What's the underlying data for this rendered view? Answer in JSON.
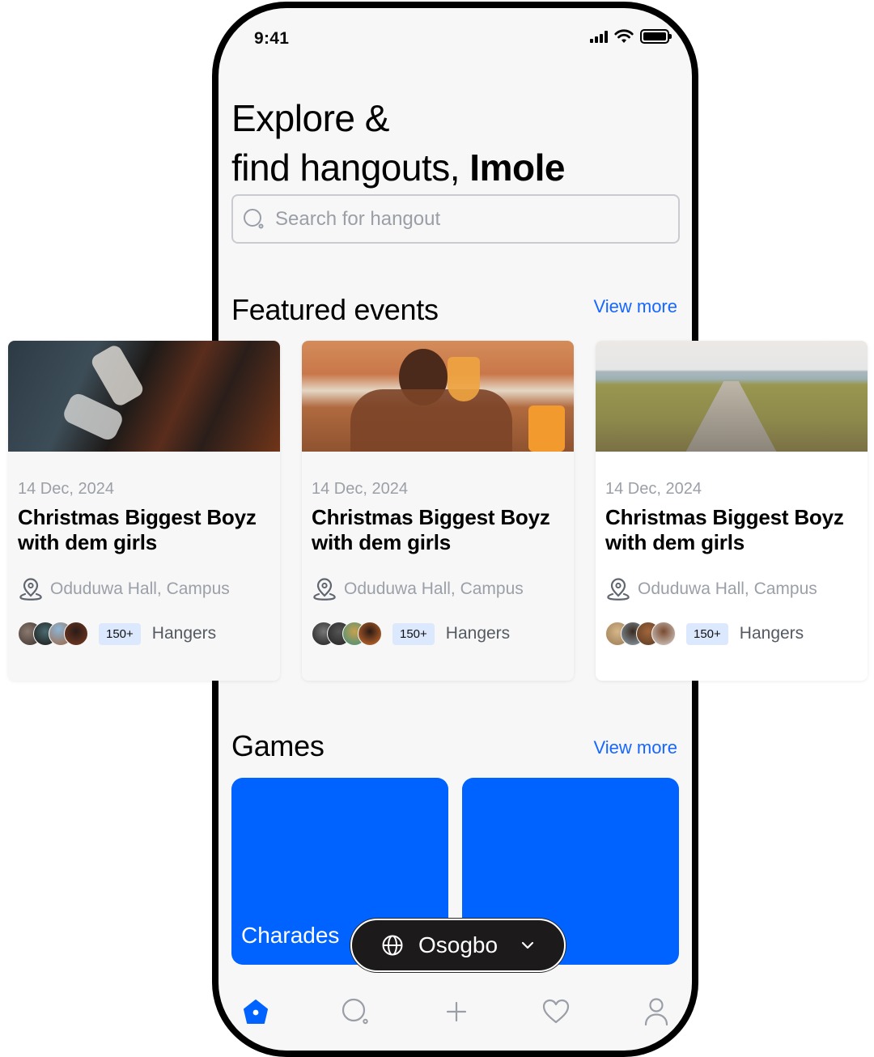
{
  "status_bar": {
    "time": "9:41"
  },
  "header": {
    "line1": "Explore &",
    "line2_prefix": "find hangouts, ",
    "user_name": "Imole"
  },
  "search": {
    "placeholder": "Search for hangout",
    "value": ""
  },
  "featured": {
    "title": "Featured events",
    "view_more": "View more",
    "events": [
      {
        "image": "sneakers-feet-out-car-window",
        "date": "14 Dec, 2024",
        "title": "Christmas Biggest Boyz with dem girls",
        "location": "Oduduwa Hall, Campus",
        "count": "150+",
        "count_label": "Hangers"
      },
      {
        "image": "friends-toasting-drinks",
        "date": "14 Dec, 2024",
        "title": "Christmas Biggest Boyz with dem girls",
        "location": "Oduduwa Hall, Campus",
        "count": "150+",
        "count_label": "Hangers"
      },
      {
        "image": "boardwalk-to-beach",
        "date": "14 Dec, 2024",
        "title": "Christmas Biggest Boyz with dem girls",
        "location": "Oduduwa Hall, Campus",
        "count": "150+",
        "count_label": "Hangers"
      }
    ]
  },
  "games": {
    "title": "Games",
    "view_more": "View more",
    "items": [
      {
        "label": "Charades"
      },
      {
        "label": ""
      }
    ]
  },
  "location_selector": {
    "city": "Osogbo",
    "icon": "globe-icon"
  },
  "tab_bar": {
    "items": [
      {
        "name": "home",
        "icon": "home-icon",
        "active": true
      },
      {
        "name": "search",
        "icon": "search-icon",
        "active": false
      },
      {
        "name": "create",
        "icon": "plus-icon",
        "active": false
      },
      {
        "name": "favorites",
        "icon": "heart-icon",
        "active": false
      },
      {
        "name": "profile",
        "icon": "user-icon",
        "active": false
      }
    ]
  },
  "colors": {
    "accent": "#0062ff",
    "link": "#1766ff",
    "badge_bg": "#dbe8fd",
    "pill_bg": "#1c1a1a"
  }
}
